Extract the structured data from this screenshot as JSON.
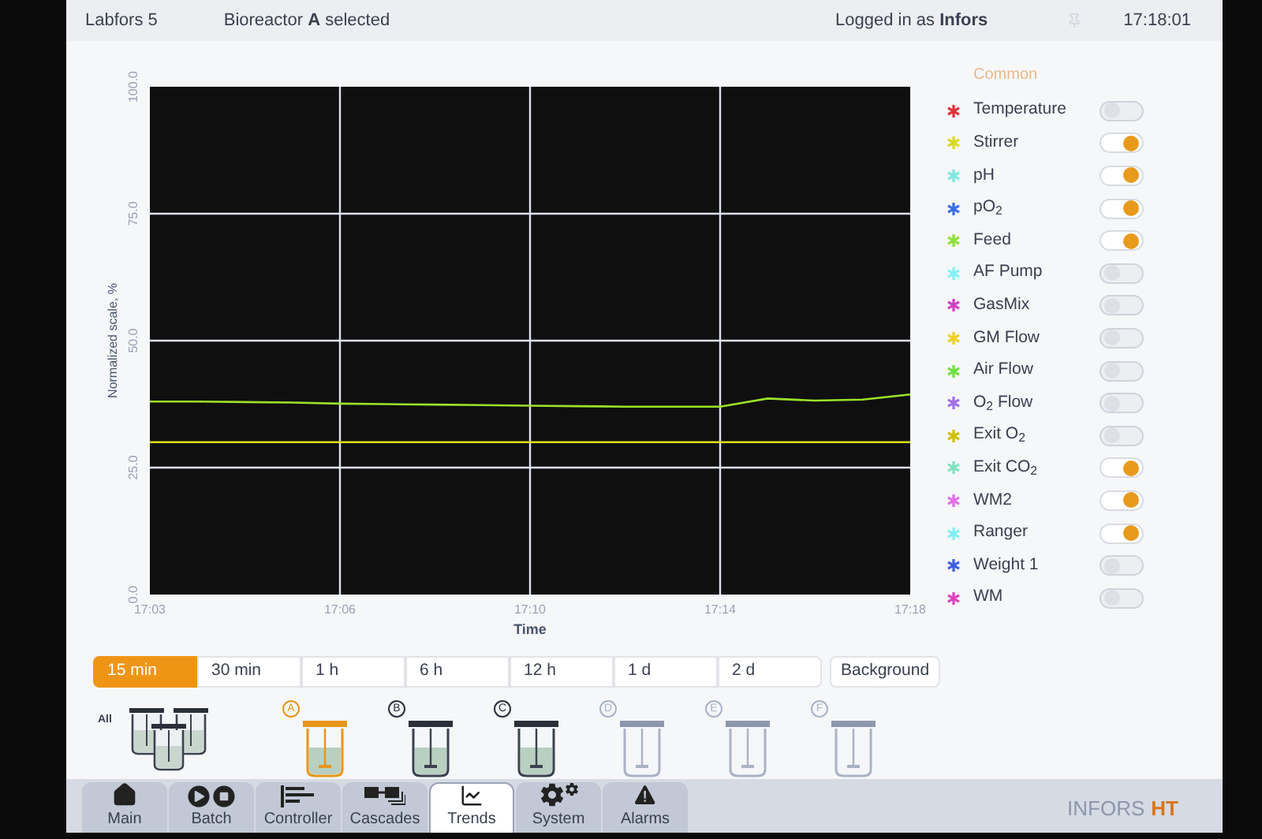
{
  "header": {
    "device": "Labfors 5",
    "selection": "Bioreactor **A** selected",
    "user": "Logged in as **Infors**",
    "time": "17:18:01"
  },
  "chart": {
    "chart_data": {
      "type": "line",
      "xlabel": "Time",
      "ylabel": "Normalized scale, %",
      "categories": [
        "17:03",
        null,
        null,
        null,
        "17:06",
        null,
        null,
        null,
        "17:10",
        null,
        null,
        null,
        "17:14",
        null,
        null,
        null,
        "17:18"
      ],
      "series": [
        {
          "color": "#9be22a",
          "values": [
            38,
            38,
            37.9,
            37.8,
            37.6,
            37.5,
            37.4,
            37.3,
            37.2,
            37.1,
            37,
            37,
            37,
            38.6,
            38.2,
            38.4,
            39.4
          ]
        },
        {
          "color": "#d9e01c",
          "values": [
            30,
            30,
            30,
            30,
            30,
            30,
            30,
            30,
            30,
            30,
            30,
            30,
            30,
            30,
            30,
            30,
            30
          ]
        }
      ],
      "ylim": [
        0,
        100
      ],
      "grid": true,
      "yticks": [
        {
          "value": 0,
          "label": "0.0"
        },
        {
          "value": 25,
          "label": "25.0"
        },
        {
          "value": 50,
          "label": "50.0"
        },
        {
          "value": 75,
          "label": "75.0"
        },
        {
          "value": 100,
          "label": "100.0"
        }
      ]
    }
  },
  "legend": {
    "title": "Common",
    "items": [
      {
        "label": "Temperature",
        "color": "#e0313a",
        "on": false
      },
      {
        "label": "Stirrer",
        "color": "#d8d820",
        "on": true
      },
      {
        "label": "pH",
        "color": "#7de8e0",
        "on": true
      },
      {
        "label": "pO$_{2}$",
        "color": "#3a6ee8",
        "on": true
      },
      {
        "label": "Feed",
        "color": "#8ee03a",
        "on": true
      },
      {
        "label": "AF Pump",
        "color": "#80f0f4",
        "on": false
      },
      {
        "label": "GasMix",
        "color": "#d040c0",
        "on": false
      },
      {
        "label": "GM Flow",
        "color": "#f0d020",
        "on": false
      },
      {
        "label": "Air Flow",
        "color": "#70e040",
        "on": false
      },
      {
        "label": "O$_{2}$ Flow",
        "color": "#a070e8",
        "on": false
      },
      {
        "label": "Exit O$_{2}$",
        "color": "#d0c000",
        "on": false
      },
      {
        "label": "Exit CO$_{2}$",
        "color": "#80e0c0",
        "on": true
      },
      {
        "label": "WM2",
        "color": "#e070e8",
        "on": true
      },
      {
        "label": "Ranger",
        "color": "#80f0f0",
        "on": true
      },
      {
        "label": "Weight 1",
        "color": "#4060e0",
        "on": false
      },
      {
        "label": "WM",
        "color": "#e040c0",
        "on": false
      }
    ]
  },
  "ranges": [
    {
      "label": "15 min",
      "selected": true
    },
    {
      "label": "30 min",
      "selected": false
    },
    {
      "label": "1 h",
      "selected": false
    },
    {
      "label": "6 h",
      "selected": false
    },
    {
      "label": "12 h",
      "selected": false
    },
    {
      "label": "1 d",
      "selected": false
    },
    {
      "label": "2 d",
      "selected": false
    }
  ],
  "background_button": "Background",
  "reactors": [
    {
      "kind": "all",
      "label": "All",
      "selected": false
    },
    {
      "kind": "single",
      "label": "A",
      "selected": true,
      "disabled": false
    },
    {
      "kind": "single",
      "label": "B",
      "selected": false,
      "disabled": false
    },
    {
      "kind": "single",
      "label": "C",
      "selected": false,
      "disabled": false
    },
    {
      "kind": "single",
      "label": "D",
      "selected": false,
      "disabled": true
    },
    {
      "kind": "single",
      "label": "E",
      "selected": false,
      "disabled": true
    },
    {
      "kind": "single",
      "label": "F",
      "selected": false,
      "disabled": true
    }
  ],
  "nav": [
    {
      "kind": "main",
      "label": "Main",
      "selected": false
    },
    {
      "kind": "batch",
      "label": "Batch",
      "selected": false
    },
    {
      "kind": "controller",
      "label": "Controller",
      "selected": false
    },
    {
      "kind": "cascades",
      "label": "Cascades",
      "selected": false
    },
    {
      "kind": "trends",
      "label": "Trends",
      "selected": true
    },
    {
      "kind": "system",
      "label": "System",
      "selected": false
    },
    {
      "kind": "alarms",
      "label": "Alarms",
      "selected": false
    }
  ],
  "logo": {
    "name": "INFORS",
    "mark": "HT"
  }
}
